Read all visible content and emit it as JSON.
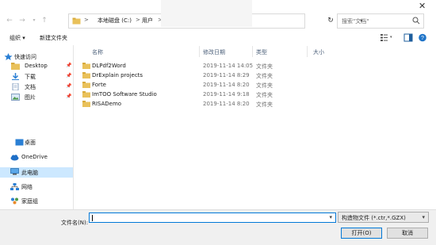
{
  "address": {
    "crumbs": [
      "本地磁盘 (C:)",
      "用户"
    ],
    "separators": [
      ">",
      ">",
      ">"
    ]
  },
  "search": {
    "placeholder": "搜索\"文档\""
  },
  "toolbar": {
    "organize": "组织 ▾",
    "new_folder": "新建文件夹"
  },
  "nav": {
    "items": [
      {
        "label": "快速访问",
        "icon": "star-icon"
      },
      {
        "label": "Desktop",
        "icon": "folder-icon"
      },
      {
        "label": "下载",
        "icon": "download-icon"
      },
      {
        "label": "文档",
        "icon": "document-icon"
      },
      {
        "label": "图片",
        "icon": "picture-icon"
      },
      {
        "label": "桌面",
        "icon": "desktop-icon"
      },
      {
        "label": "OneDrive",
        "icon": "cloud-icon"
      },
      {
        "label": "此电脑",
        "icon": "computer-icon"
      },
      {
        "label": "网络",
        "icon": "network-icon"
      },
      {
        "label": "家庭组",
        "icon": "homegroup-icon"
      }
    ]
  },
  "columns": {
    "name": "名称",
    "date": "修改日期",
    "type": "类型",
    "size": "大小"
  },
  "files": [
    {
      "name": "DLPdf2Word",
      "date": "2019-11-14 14:05",
      "type": "文件夹"
    },
    {
      "name": "DrExplain projects",
      "date": "2019-11-14 8:29",
      "type": "文件夹"
    },
    {
      "name": "Forte",
      "date": "2019-11-14 8:20",
      "type": "文件夹"
    },
    {
      "name": "ImTOO Software Studio",
      "date": "2019-11-14 9:18",
      "type": "文件夹"
    },
    {
      "name": "RISADemo",
      "date": "2019-11-14 8:20",
      "type": "文件夹"
    }
  ],
  "bottom": {
    "filename_label": "文件名(N):",
    "filename_value": "",
    "filter_value": "构造物文件 (*.ctr,*.GZX)",
    "open_label": "打开(O)",
    "cancel_label": "取消"
  },
  "colors": {
    "accent": "#0078d7",
    "folder": "#e9c15a",
    "selected": "#cce8ff"
  }
}
